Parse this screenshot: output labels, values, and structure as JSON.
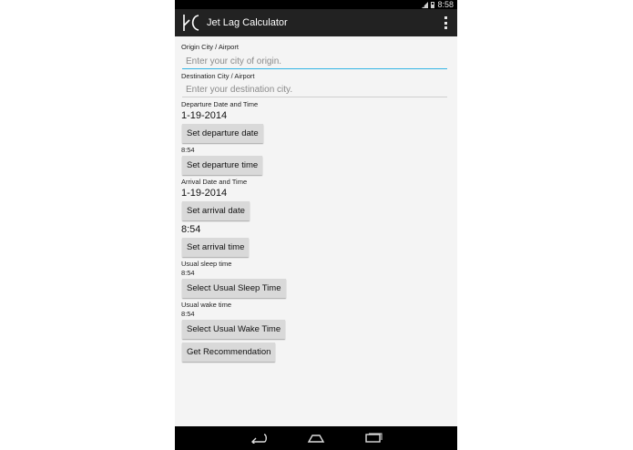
{
  "status_bar": {
    "time": "8:58"
  },
  "app": {
    "title": "Jet Lag Calculator"
  },
  "form": {
    "origin": {
      "label": "Origin City / Airport",
      "placeholder": "Enter your city of origin.",
      "value": ""
    },
    "destination": {
      "label": "Destination City / Airport",
      "placeholder": "Enter your destination city.",
      "value": ""
    },
    "departure": {
      "label": "Departure Date and Time",
      "date": "1-19-2014",
      "date_button": "Set departure date",
      "time": "8:54",
      "time_button": "Set departure time"
    },
    "arrival": {
      "label": "Arrival Date and Time",
      "date": "1-19-2014",
      "date_button": "Set arrival date",
      "time": "8:54",
      "time_button": "Set arrival time"
    },
    "sleep": {
      "label": "Usual sleep time",
      "time": "8:54",
      "button": "Select Usual Sleep Time"
    },
    "wake": {
      "label": "Usual wake time",
      "time": "8:54",
      "button": "Select Usual Wake Time"
    },
    "submit_button": "Get Recommendation"
  },
  "icons": {
    "back": "back-icon",
    "home": "home-icon",
    "recents": "recents-icon",
    "overflow": "overflow-menu-icon",
    "signal": "signal-icon",
    "battery": "battery-icon",
    "logo": "app-logo-icon"
  }
}
